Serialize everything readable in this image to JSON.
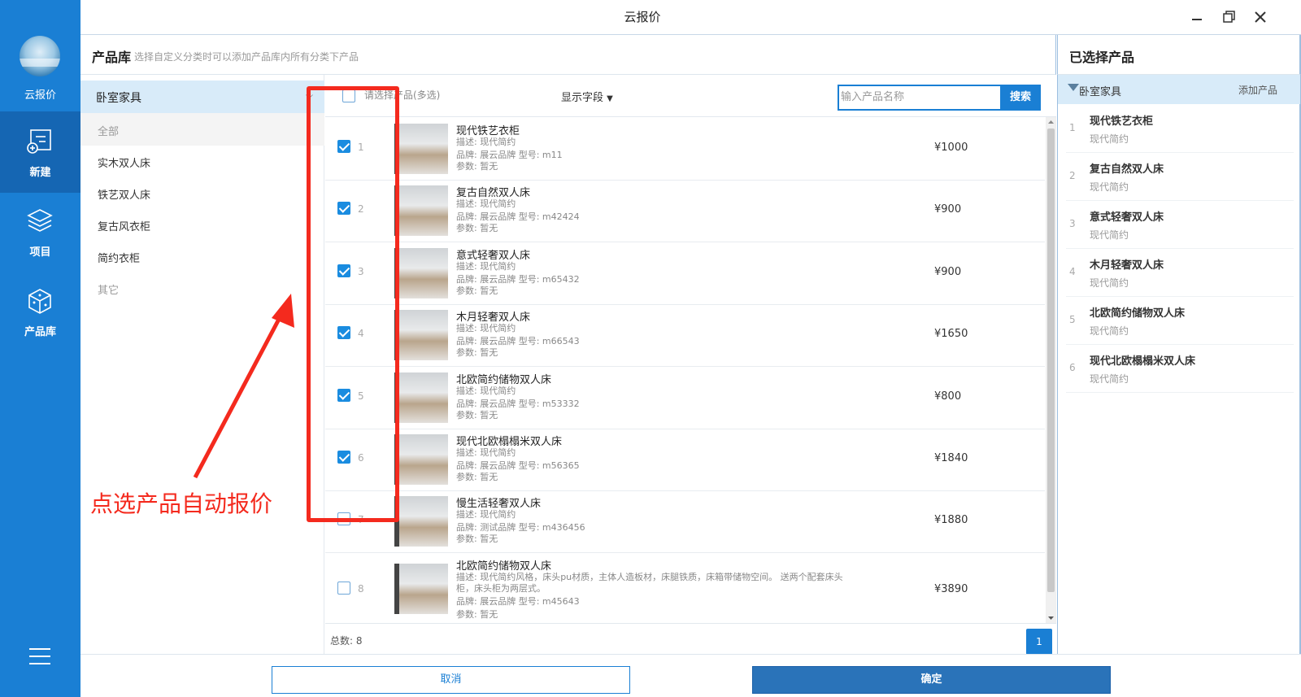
{
  "app": {
    "title": "云报价",
    "logo_label": "云报价"
  },
  "sidebar": {
    "items": [
      {
        "label": "新建",
        "icon": "new-quote-icon"
      },
      {
        "label": "项目",
        "icon": "layers-icon"
      },
      {
        "label": "产品库",
        "icon": "cube-icon"
      }
    ],
    "menu_icon": "hamburger-icon"
  },
  "header": {
    "title": "产品库",
    "hint": "选择自定义分类时可以添加产品库内所有分类下产品",
    "right_title": "已选择产品"
  },
  "categories": {
    "group": "卧室家具",
    "items": [
      "全部",
      "实木双人床",
      "铁艺双人床",
      "复古风衣柜",
      "简约衣柜",
      "其它"
    ],
    "selected": "全部"
  },
  "list": {
    "select_all_label": "请选择产品(多选)",
    "fields_label": "显示字段",
    "search_placeholder": "输入产品名称",
    "search_button": "搜索",
    "total_label": "总数: 8",
    "page": "1",
    "rows": [
      {
        "num": "1",
        "checked": true,
        "name": "现代铁艺衣柜",
        "desc": "描述: 现代简约",
        "brand": "品牌: 展云品牌 型号: m11",
        "params": "参数: 暂无",
        "price": "¥1000"
      },
      {
        "num": "2",
        "checked": true,
        "name": "复古自然双人床",
        "desc": "描述: 现代简约",
        "brand": "品牌: 展云品牌 型号: m42424",
        "params": "参数: 暂无",
        "price": "¥900"
      },
      {
        "num": "3",
        "checked": true,
        "name": "意式轻奢双人床",
        "desc": "描述: 现代简约",
        "brand": "品牌: 展云品牌 型号: m65432",
        "params": "参数: 暂无",
        "price": "¥900"
      },
      {
        "num": "4",
        "checked": true,
        "name": "木月轻奢双人床",
        "desc": "描述: 现代简约",
        "brand": "品牌: 展云品牌 型号: m66543",
        "params": "参数: 暂无",
        "price": "¥1650"
      },
      {
        "num": "5",
        "checked": true,
        "name": "北欧简约储物双人床",
        "desc": "描述: 现代简约",
        "brand": "品牌: 展云品牌 型号: m53332",
        "params": "参数: 暂无",
        "price": "¥800"
      },
      {
        "num": "6",
        "checked": true,
        "name": "现代北欧榻榻米双人床",
        "desc": "描述: 现代简约",
        "brand": "品牌: 展云品牌 型号: m56365",
        "params": "参数: 暂无",
        "price": "¥1840"
      },
      {
        "num": "7",
        "checked": false,
        "name": "慢生活轻奢双人床",
        "desc": "描述: 现代简约",
        "brand": "品牌: 测试品牌 型号: m436456",
        "params": "参数: 暂无",
        "price": "¥1880"
      },
      {
        "num": "8",
        "checked": false,
        "name": "北欧简约储物双人床",
        "desc": "描述: 现代简约风格，床头pu材质，主体人造板材，床腿铁质，床箱带储物空间。 送两个配套床头柜，床头柜为两层式。",
        "brand": "品牌: 展云品牌 型号: m45643",
        "params": "参数: 暂无",
        "price": "¥3890"
      }
    ]
  },
  "selected": {
    "group": "卧室家具",
    "add_label": "添加产品",
    "items": [
      {
        "num": "1",
        "name": "现代铁艺衣柜",
        "sub": "现代简约"
      },
      {
        "num": "2",
        "name": "复古自然双人床",
        "sub": "现代简约"
      },
      {
        "num": "3",
        "name": "意式轻奢双人床",
        "sub": "现代简约"
      },
      {
        "num": "4",
        "name": "木月轻奢双人床",
        "sub": "现代简约"
      },
      {
        "num": "5",
        "name": "北欧简约储物双人床",
        "sub": "现代简约"
      },
      {
        "num": "6",
        "name": "现代北欧榻榻米双人床",
        "sub": "现代简约"
      }
    ]
  },
  "footer": {
    "cancel": "取消",
    "ok": "确定"
  },
  "annotation": {
    "text": "点选产品自动报价",
    "color": "#f42a1e"
  },
  "colors": {
    "accent": "#1a7fd4",
    "sidebar_active": "#1566b3",
    "highlight_row": "#d8ebf9"
  }
}
